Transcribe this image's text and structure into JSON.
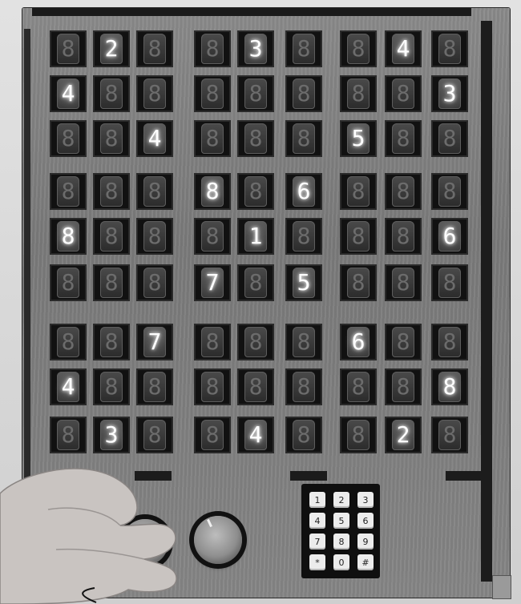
{
  "scene": {
    "description_label": "",
    "digits_lit": [
      [
        "",
        "2",
        "",
        "",
        "3",
        "",
        "",
        "4",
        ""
      ],
      [
        "4",
        "",
        "",
        "",
        "",
        "",
        "",
        "",
        "3"
      ],
      [
        "",
        "",
        "4",
        "",
        "",
        "",
        "5",
        "",
        ""
      ],
      [
        "",
        "",
        "",
        "8",
        "",
        "6",
        "",
        "",
        ""
      ],
      [
        "8",
        "",
        "",
        "",
        "1",
        "",
        "",
        "",
        "6"
      ],
      [
        "",
        "",
        "",
        "7",
        "",
        "5",
        "",
        "",
        ""
      ],
      [
        "",
        "",
        "7",
        "",
        "",
        "",
        "6",
        "",
        ""
      ],
      [
        "4",
        "",
        "",
        "",
        "",
        "",
        "",
        "",
        "8"
      ],
      [
        "",
        "3",
        "",
        "",
        "4",
        "",
        "",
        "2",
        ""
      ]
    ],
    "unlit_glyph": "8"
  },
  "keypad": {
    "keys": [
      "1",
      "2",
      "3",
      "4",
      "5",
      "6",
      "7",
      "8",
      "9",
      "*",
      "0",
      "#"
    ]
  },
  "colors": {
    "board": "#808080",
    "cell": "#111111",
    "lit_digit": "#ffffff",
    "unlit_digit": "#6c6c6c"
  }
}
